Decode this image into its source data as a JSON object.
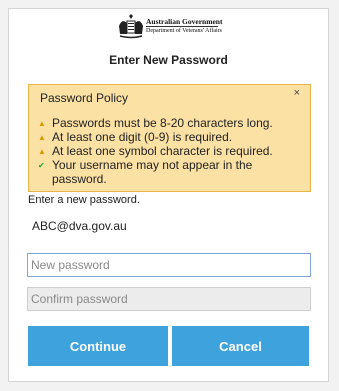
{
  "header": {
    "crest_line1": "Australian Government",
    "crest_line2": "Department of Veterans' Affairs",
    "title": "Enter New Password"
  },
  "policy": {
    "title": "Password Policy",
    "close_label": "×",
    "rules": [
      {
        "text": "Passwords must be 8-20 characters long.",
        "status": "warning"
      },
      {
        "text": "At least one digit (0-9) is required.",
        "status": "warning"
      },
      {
        "text": "At least one symbol character is required.",
        "status": "warning"
      },
      {
        "text": "Your username may not appear in the password.",
        "status": "ok"
      }
    ]
  },
  "form": {
    "hint": "Enter a new password.",
    "username": "ABC@dva.gov.au",
    "new_password_placeholder": "New password",
    "confirm_password_placeholder": "Confirm password"
  },
  "buttons": {
    "continue_label": "Continue",
    "cancel_label": "Cancel"
  },
  "colors": {
    "button": "#3ea3dc",
    "policy_bg": "#fce1a4",
    "policy_border": "#e8b54a",
    "warning": "#d49a00",
    "ok": "#2aa02a"
  }
}
